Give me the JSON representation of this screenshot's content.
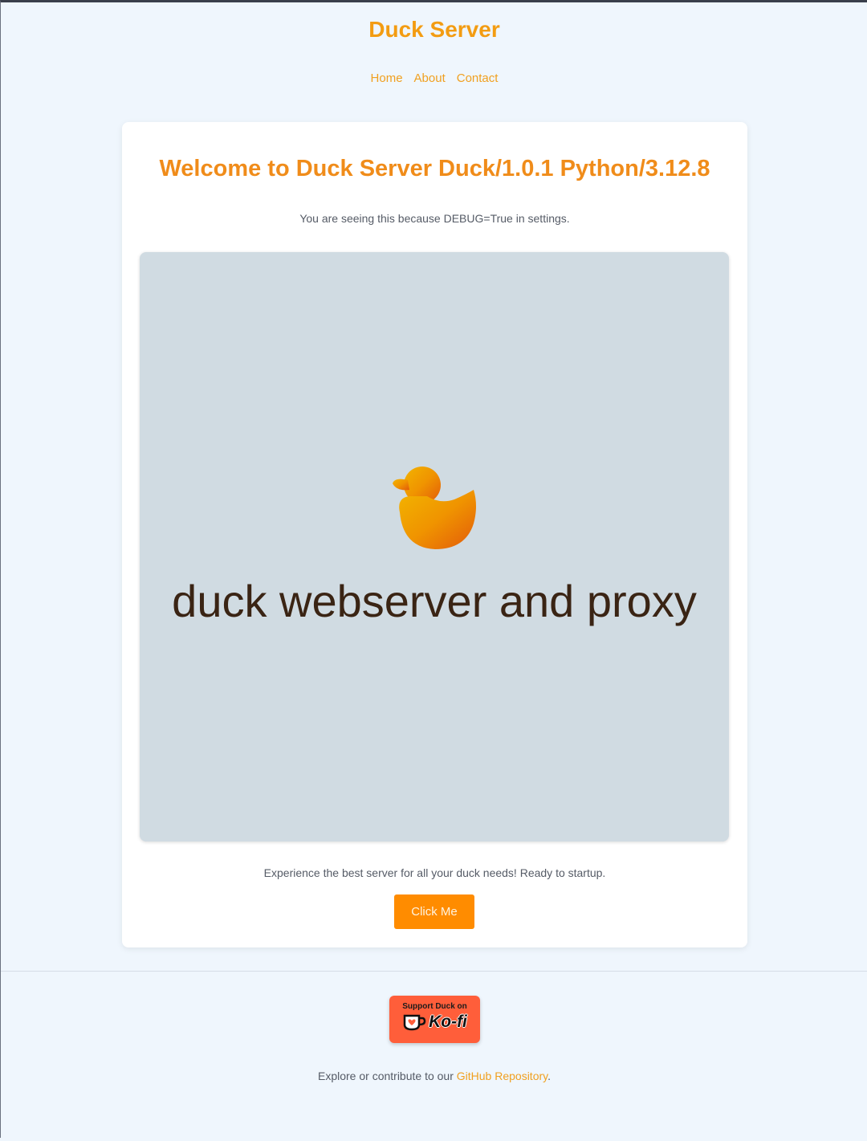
{
  "header": {
    "title": "Duck Server",
    "nav": [
      "Home",
      "About",
      "Contact"
    ]
  },
  "main": {
    "heading": "Welcome to Duck Server Duck/1.0.1 Python/3.12.8",
    "debug_note": "You are seeing this because DEBUG=True in settings.",
    "hero": {
      "icon": "duck-icon",
      "text": "duck webserver and proxy"
    },
    "tagline": "Experience the best server for all your duck needs! Ready to startup.",
    "button_label": "Click Me"
  },
  "footer": {
    "kofi_top": "Support Duck on",
    "kofi_word": "Ko-fi",
    "explore_prefix": "Explore or contribute to our ",
    "repo_link": "GitHub Repository",
    "explore_suffix": "."
  },
  "colors": {
    "accent": "#f39c12",
    "button": "#ff8c00",
    "kofi": "#ff5e3a",
    "page_bg": "#eff6fd",
    "hero_bg": "#d0dbe2"
  }
}
